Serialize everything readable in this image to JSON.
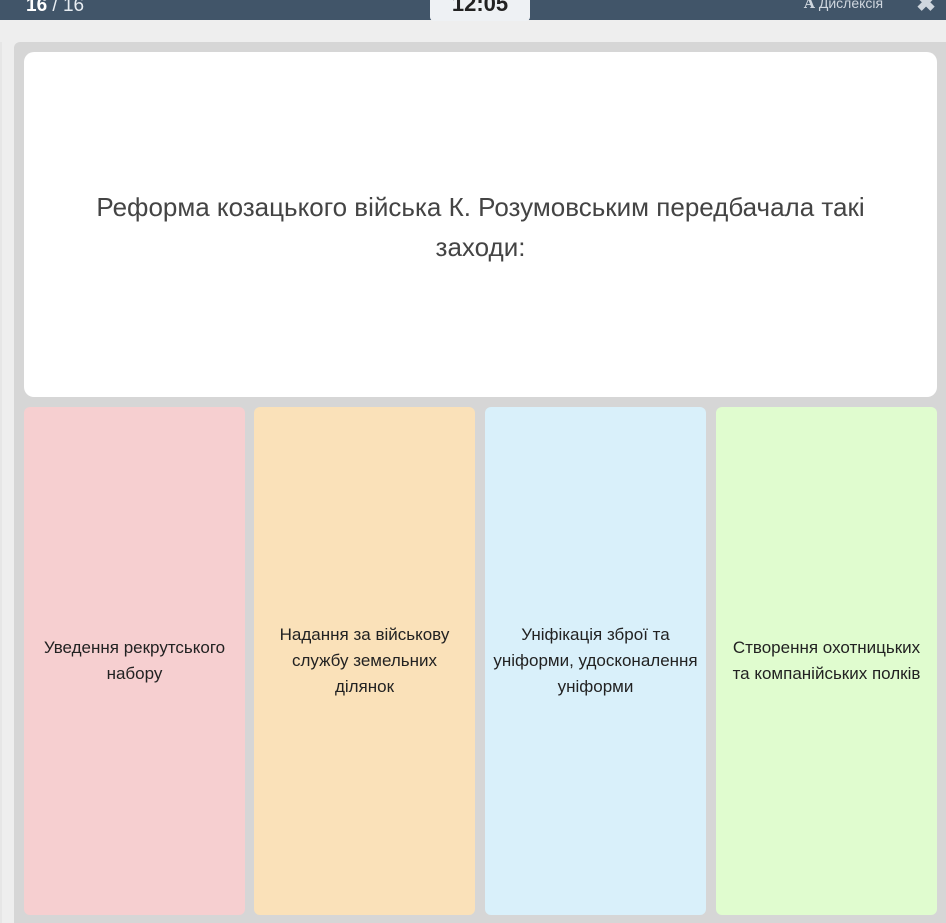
{
  "header": {
    "question_current": "16",
    "question_separator": "/",
    "question_total": "16",
    "timer": "12:05",
    "dyslexia_icon_letter": "A",
    "dyslexia_label": "Дислексія",
    "close_icon": "close-icon"
  },
  "question": {
    "text": "Реформа козацького війська К. Розумовським передбачала такі заходи:"
  },
  "answers": [
    {
      "label": "Уведення рекрутського набору",
      "color": "#f6cfd0"
    },
    {
      "label": "Надання за військову службу земельних ділянок",
      "color": "#fae1b9"
    },
    {
      "label": "Уніфікація зброї та уніформи, удосконалення уніформи",
      "color": "#d9f0fa"
    },
    {
      "label": "Створення охотницьких та компанійських полків",
      "color": "#e0fccf"
    }
  ],
  "colors": {
    "topbar": "#415569",
    "panel": "#d6d6d6",
    "card": "#ffffff"
  }
}
